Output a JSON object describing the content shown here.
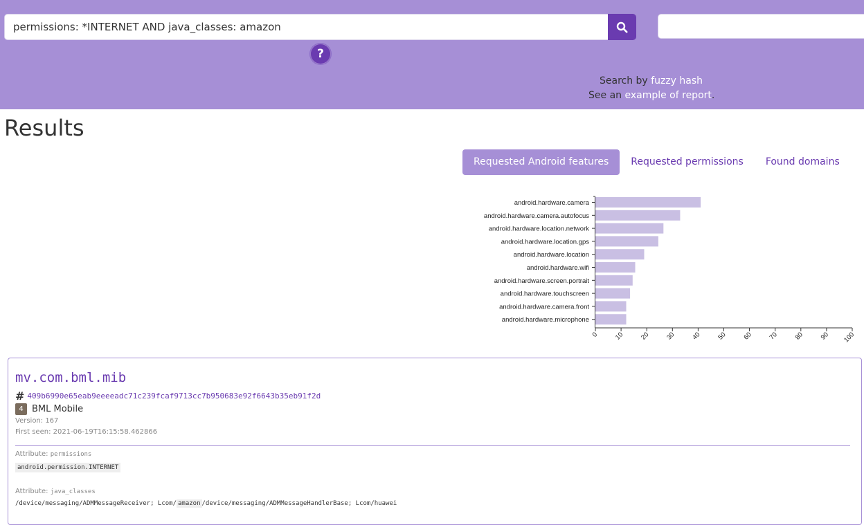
{
  "search": {
    "query": "permissions: *INTERNET AND java_classes: amazon",
    "fuzzy_value": ""
  },
  "help": {
    "label": "?"
  },
  "side": {
    "search_by": "Search by",
    "fuzzy_hash": "fuzzy hash",
    "see_an": "See an",
    "example_report": "example of report",
    "dot": "."
  },
  "results": {
    "title": "Results"
  },
  "tabs": [
    {
      "label": "Requested Android features",
      "active": true
    },
    {
      "label": "Requested permissions",
      "active": false
    },
    {
      "label": "Found domains",
      "active": false
    }
  ],
  "chart_data": {
    "type": "bar",
    "orientation": "horizontal",
    "categories": [
      "android.hardware.camera",
      "android.hardware.camera.autofocus",
      "android.hardware.location.network",
      "android.hardware.location.gps",
      "android.hardware.location",
      "android.hardware.wifi",
      "android.hardware.screen.portrait",
      "android.hardware.touchscreen",
      "android.hardware.camera.front",
      "android.hardware.microphone"
    ],
    "values": [
      41,
      33,
      26.5,
      24.5,
      19,
      15.5,
      14.5,
      13.5,
      12,
      12
    ],
    "xlim": [
      0,
      100
    ],
    "xticks": [
      0,
      10,
      20,
      30,
      40,
      50,
      60,
      70,
      80,
      90,
      100
    ],
    "bar_color": "#c9bfe3"
  },
  "result": {
    "package": "mv.com.bml.mib",
    "hash_icon": "#",
    "hash": "409b6990e65eab9eeeeadc71c239fcaf9713cc7b950683e92f6643b35eb91f2d",
    "app_icon_label": "4",
    "app_name": "BML Mobile",
    "version": "Version: 167",
    "first_seen": "First seen: 2021-06-19T16:15:58.462866",
    "attr1_label": "Attribute:",
    "attr1_name": "permissions",
    "attr1_value": "android.permission.INTERNET",
    "attr2_label": "Attribute:",
    "attr2_name": "java_classes",
    "classes_before": "/device/messaging/ADMMessageReceiver; Lcom/",
    "classes_match": "amazon",
    "classes_after": "/device/messaging/ADMMessageHandlerBase; Lcom/huawei"
  },
  "colors": {
    "brand": "#a68fd6",
    "accent": "#6a3bb0"
  }
}
